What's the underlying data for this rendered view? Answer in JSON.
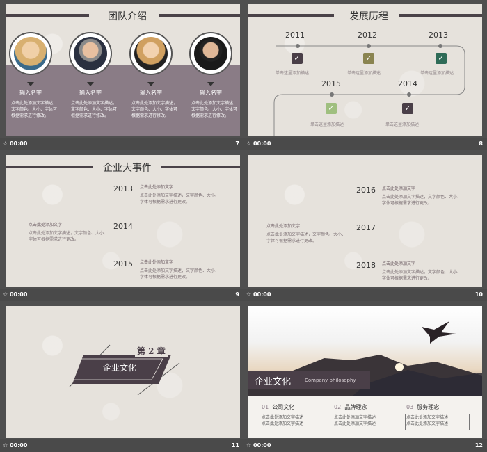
{
  "slides": [
    {
      "num": "7",
      "time": "00:00",
      "title": "团队介绍",
      "members": [
        {
          "name": "输入名字",
          "desc": "点击此处添加文字描述，文字颜色、大小、字体可根据需求进行修改。"
        },
        {
          "name": "输入名字",
          "desc": "点击此处添加文字描述，文字颜色、大小、字体可根据需求进行修改。"
        },
        {
          "name": "输入名字",
          "desc": "点击此处添加文字描述，文字颜色、大小、字体可根据需求进行修改。"
        },
        {
          "name": "输入名字",
          "desc": "点击此处添加文字描述，文字颜色、大小、字体可根据需求进行修改。"
        }
      ]
    },
    {
      "num": "8",
      "time": "00:00",
      "title": "发展历程",
      "events": [
        {
          "year": "2011",
          "text": "单击这里添加描述"
        },
        {
          "year": "2012",
          "text": "单击这里添加描述"
        },
        {
          "year": "2013",
          "text": "单击这里添加描述"
        },
        {
          "year": "2015",
          "text": "单击这里添加描述"
        },
        {
          "year": "2014",
          "text": "单击这里添加描述"
        }
      ]
    },
    {
      "num": "9",
      "time": "00:00",
      "title": "企业大事件",
      "years": [
        "2013",
        "2014",
        "2015"
      ],
      "heading": "点击此处添加文字",
      "body": "点击此处添加文字描述，文字颜色、大小、字体可根据需求进行更改。"
    },
    {
      "num": "10",
      "time": "00:00",
      "years": [
        "2016",
        "2017",
        "2018"
      ],
      "heading": "点击此处添加文字",
      "body": "点击此处添加文字描述，文字颜色、大小、字体可根据需求进行更改。"
    },
    {
      "num": "11",
      "time": "00:00",
      "chapter": "第 2 章",
      "chapter_title": "企业文化"
    },
    {
      "num": "12",
      "time": "00:00",
      "banner_cn": "企业文化",
      "banner_en": "Company philosophy",
      "items": [
        {
          "idx": "01",
          "label": "公司文化",
          "text": "点击此处添加文字描述"
        },
        {
          "idx": "02",
          "label": "品牌理念",
          "text": "点击此处添加文字描述"
        },
        {
          "idx": "03",
          "label": "服务理念",
          "text": "点击此处添加文字描述"
        }
      ]
    }
  ],
  "colors": {
    "accent": "#4a4248",
    "band": "#8a7c86",
    "check_dark": "#4a3f48",
    "check_olive": "#8a8450",
    "check_green": "#2e6b57",
    "check_light": "#9fbf7f"
  }
}
